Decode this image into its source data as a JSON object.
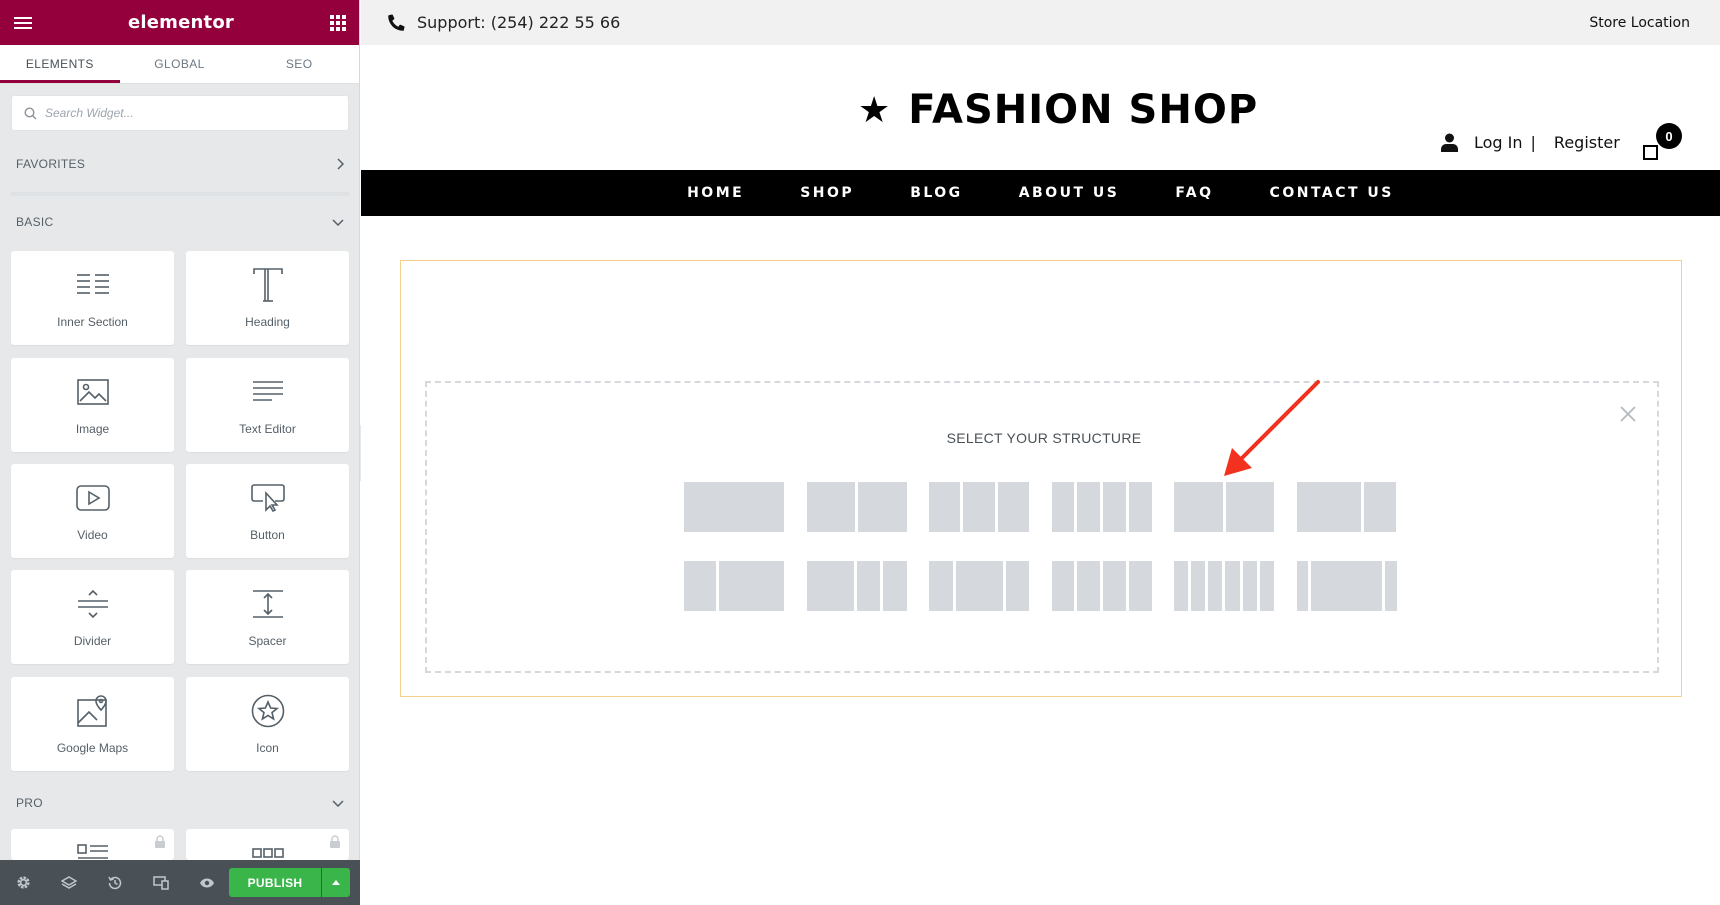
{
  "panel": {
    "brand": "elementor",
    "tabs": [
      {
        "label": "ELEMENTS"
      },
      {
        "label": "GLOBAL"
      },
      {
        "label": "SEO"
      }
    ],
    "search_placeholder": "Search Widget...",
    "categories": {
      "favorites": "FAVORITES",
      "basic": "BASIC",
      "pro": "PRO"
    },
    "widgets": [
      {
        "label": "Inner Section",
        "icon": "inner-section-icon"
      },
      {
        "label": "Heading",
        "icon": "heading-icon"
      },
      {
        "label": "Image",
        "icon": "image-icon"
      },
      {
        "label": "Text Editor",
        "icon": "text-editor-icon"
      },
      {
        "label": "Video",
        "icon": "video-icon"
      },
      {
        "label": "Button",
        "icon": "button-icon"
      },
      {
        "label": "Divider",
        "icon": "divider-icon"
      },
      {
        "label": "Spacer",
        "icon": "spacer-icon"
      },
      {
        "label": "Google Maps",
        "icon": "google-maps-icon"
      },
      {
        "label": "Icon",
        "icon": "star-icon"
      }
    ],
    "footer": {
      "publish_label": "PUBLISH"
    },
    "colors": {
      "brand": "#93003c",
      "publish": "#39b54a",
      "footer": "#495157"
    }
  },
  "site": {
    "topbar": {
      "support": "Support: (254) 222 55 66",
      "store_location": "Store Location"
    },
    "logo_text": "FASHION SHOP",
    "account": {
      "login": "Log In",
      "separator": "|",
      "register": "Register"
    },
    "cart_count": "0",
    "nav": [
      "HOME",
      "SHOP",
      "BLOG",
      "ABOUT US",
      "FAQ",
      "CONTACT US"
    ]
  },
  "structure_selector": {
    "title": "SELECT YOUR STRUCTURE",
    "presets_row1": [
      [
        1
      ],
      [
        1,
        1
      ],
      [
        1,
        1,
        1
      ],
      [
        1,
        1,
        1,
        1
      ],
      [
        1,
        1
      ],
      [
        2,
        1
      ]
    ],
    "presets_row2": [
      [
        1,
        2
      ],
      [
        2,
        1,
        1
      ],
      [
        1,
        2,
        1
      ],
      [
        1,
        1,
        1,
        1
      ],
      [
        1,
        1,
        1,
        1,
        1,
        1
      ],
      [
        1,
        6,
        1
      ]
    ]
  }
}
